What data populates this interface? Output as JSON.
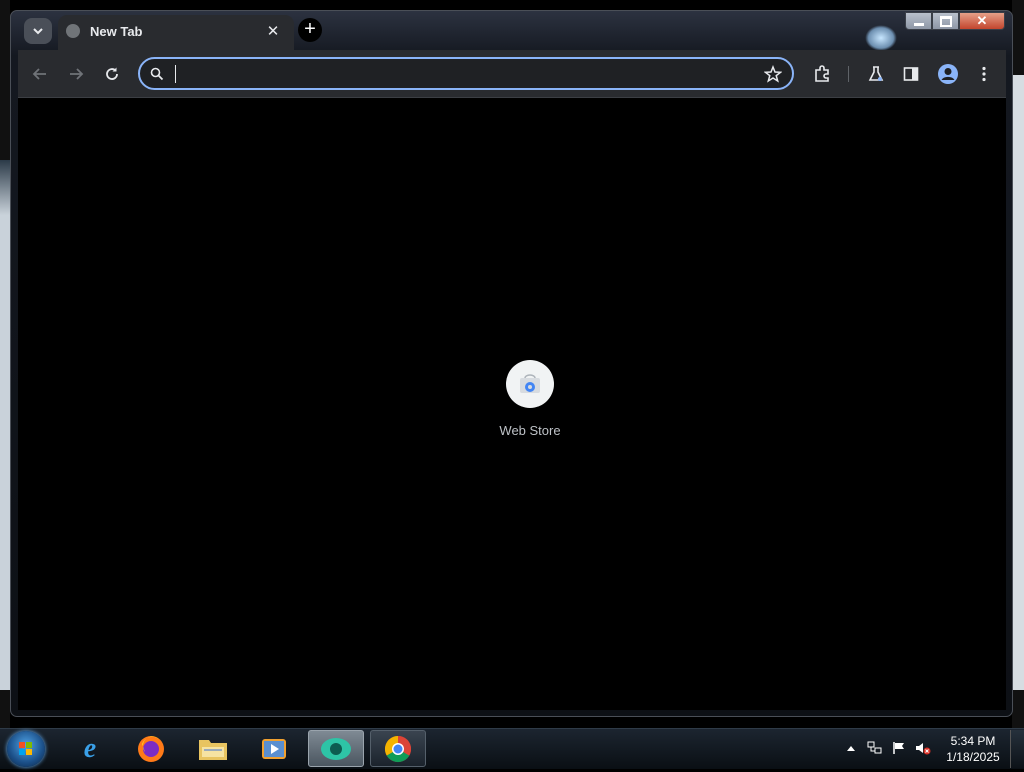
{
  "browser": {
    "tab": {
      "title": "New Tab",
      "close_symbol": "✕"
    },
    "new_tab_symbol": "+",
    "omnibox": {
      "value": "",
      "placeholder": ""
    },
    "colors": {
      "accent": "#8ab4f8",
      "toolbar": "#292b2f",
      "content": "#000000"
    }
  },
  "window_controls": {
    "minimize": "minimize",
    "maximize": "maximize",
    "close": "close"
  },
  "shortcuts": [
    {
      "label": "Web Store"
    }
  ],
  "taskbar": {
    "pinned": [
      "internet-explorer",
      "firefox",
      "file-explorer",
      "media-player",
      "app-viewer",
      "chrome"
    ],
    "clock": {
      "time": "5:34 PM",
      "date": "1/18/2025"
    }
  }
}
